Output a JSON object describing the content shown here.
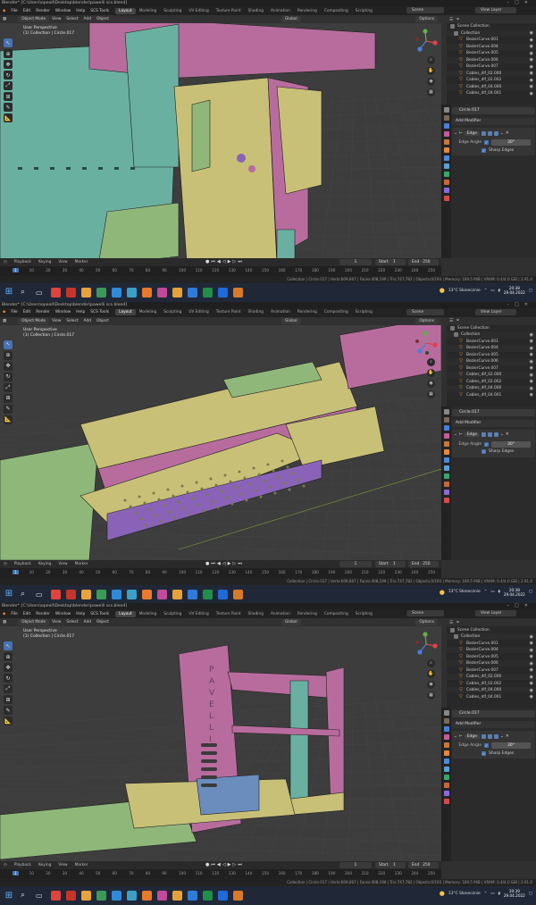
{
  "blender": {
    "title": "Blender* [C:\\Users\\opeoll\\Desktop\\blender\\pawelli scs.blend]",
    "menu": [
      "File",
      "Edit",
      "Render",
      "Window",
      "Help",
      "SCS Tools"
    ],
    "workspaces": [
      "Layout",
      "Modeling",
      "Sculpting",
      "UV Editing",
      "Texture Paint",
      "Shading",
      "Animation",
      "Rendering",
      "Compositing",
      "Scripting"
    ],
    "active_workspace": "Layout",
    "scene": "Scene",
    "view_layer": "View Layer",
    "viewport_header": {
      "mode": "Object Mode",
      "menus": [
        "View",
        "Select",
        "Add",
        "Object"
      ],
      "transform": "Global",
      "options": "Options"
    },
    "viewport_info": {
      "line1": "User Perspective",
      "line2": "(1) Collection | Circle.017"
    },
    "outliner": {
      "items": [
        {
          "label": "Scene Collection",
          "type": "col"
        },
        {
          "label": "Collection",
          "type": "col"
        },
        {
          "label": "BezierCurve.001",
          "type": "crv"
        },
        {
          "label": "BezierCurve.004",
          "type": "crv"
        },
        {
          "label": "BezierCurve.005",
          "type": "crv"
        },
        {
          "label": "BezierCurve.006",
          "type": "crv"
        },
        {
          "label": "BezierCurve.007",
          "type": "crv"
        },
        {
          "label": "Cables_dlf_02.000",
          "type": "crv"
        },
        {
          "label": "Cables_dlf_02.002",
          "type": "crv"
        },
        {
          "label": "Cables_dlf_04.000",
          "type": "crv"
        },
        {
          "label": "Cables_dlf_04.001",
          "type": "crv"
        }
      ]
    },
    "properties": {
      "object": "Circle.017",
      "add_modifier": "Add Modifier",
      "modifier": "Edge",
      "edge_angle_label": "Edge Angle",
      "edge_angle_value": "30°",
      "sharp_edges": "Sharp Edges"
    },
    "timeline": {
      "menus": [
        "Playback",
        "Keying",
        "View",
        "Marker"
      ],
      "current_frame": "1",
      "start_label": "Start",
      "start": "1",
      "end_label": "End",
      "end": "250",
      "ticks": [
        "1",
        "10",
        "20",
        "30",
        "40",
        "50",
        "60",
        "70",
        "80",
        "90",
        "100",
        "110",
        "120",
        "130",
        "140",
        "150",
        "160",
        "170",
        "180",
        "190",
        "200",
        "210",
        "220",
        "230",
        "240",
        "250"
      ]
    },
    "status": "Collection | Circle.017 | Verts:609,667 | Faces:408,199 | Tris:747,782 | Objects:0/193 | Memory: 169.5 MiB | VRAM: 0.4/4.0 GiB | 2.91.0"
  },
  "taskbar": {
    "weather": "13°C  Słonecznie",
    "date": "29.04.2022",
    "times": [
      "20:38",
      "20:38",
      "20:39"
    ],
    "app_colors": [
      "#e0443a",
      "#c8342a",
      "#e8a33a",
      "#3b9a57",
      "#2f8ad8",
      "#3aa0c8",
      "#e87a2b",
      "#c24a9b",
      "#e6a23a",
      "#2f7bd8",
      "#1f8f4a",
      "#1f6ad8",
      "#d87a2b"
    ]
  },
  "scene_colors": {
    "pink": "#b86c9e",
    "teal": "#6ab0a0",
    "green": "#8fb77a",
    "yellow": "#c9c078",
    "blue": "#6a8dbd",
    "purple": "#8a63b8"
  }
}
